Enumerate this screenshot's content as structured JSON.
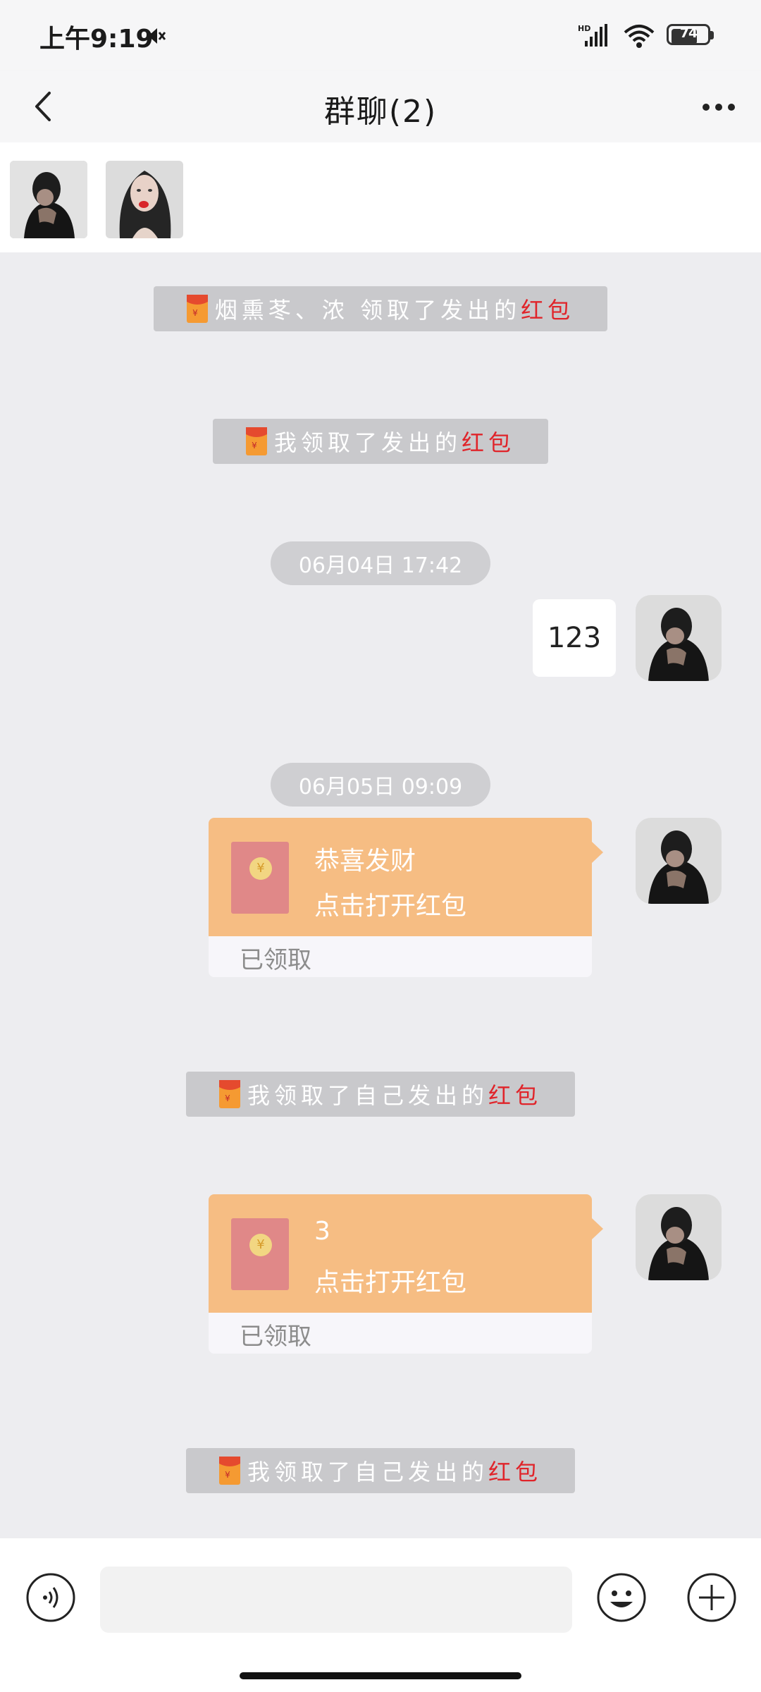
{
  "status_bar": {
    "time": "上午9:19",
    "battery": "74",
    "battery_level": 0.74
  },
  "header": {
    "title": "群聊(2)"
  },
  "members": [
    {
      "name": "member-avatar-1"
    },
    {
      "name": "member-avatar-2"
    }
  ],
  "chat": {
    "notice_1": {
      "name_part": "烟熏苳、浓 领取了发出的",
      "red_word": "红包"
    },
    "notice_2": {
      "name_part": "我领取了发出的",
      "red_word": "红包"
    },
    "time_1": "06月04日 17:42",
    "text_message": "123",
    "time_2": "06月05日 09:09",
    "redpacket_1": {
      "title": "恭喜发财",
      "subtitle": "点击打开红包",
      "status": "已领取"
    },
    "notice_3": {
      "name_part": "我领取了自己发出的",
      "red_word": "红包"
    },
    "redpacket_2": {
      "title": "3",
      "subtitle": "点击打开红包",
      "status": "已领取"
    },
    "notice_4": {
      "name_part": "我领取了自己发出的",
      "red_word": "红包"
    },
    "coin_symbol": "¥"
  },
  "input_bar": {
    "value": "",
    "placeholder": ""
  },
  "colors": {
    "redpacket_top": "#f6bd83",
    "redpacket_envelope": "#e08888",
    "red_word": "#e0242a",
    "chat_background": "#ededf0"
  }
}
